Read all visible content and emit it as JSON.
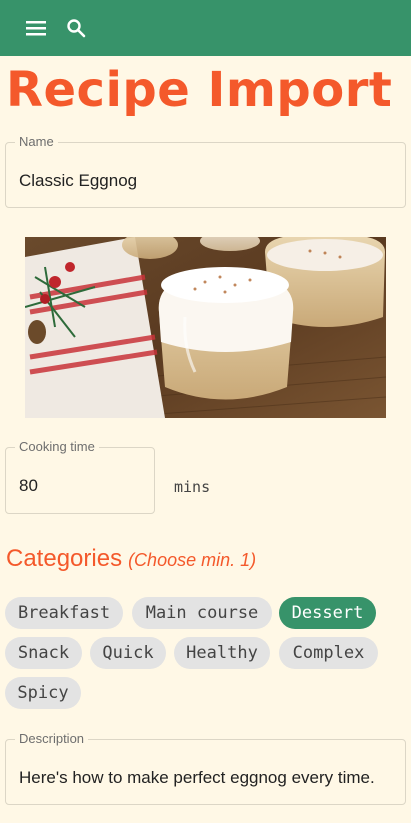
{
  "header": {
    "menu_icon": "menu-icon",
    "search_icon": "search-icon",
    "bar_color": "#37936a"
  },
  "page": {
    "title": "Recipe Import",
    "title_color": "#f4592b"
  },
  "name_field": {
    "label": "Name",
    "value": "Classic Eggnog"
  },
  "hero_image": {
    "subject": "eggnog glasses topped with whipped cream"
  },
  "cooking_time": {
    "label": "Cooking time",
    "value": "80",
    "unit": "mins"
  },
  "categories": {
    "heading": "Categories",
    "hint": "(Choose min. 1)",
    "items": [
      {
        "label": "Breakfast",
        "selected": false
      },
      {
        "label": "Main course",
        "selected": false
      },
      {
        "label": "Dessert",
        "selected": true
      },
      {
        "label": "Snack",
        "selected": false
      },
      {
        "label": "Quick",
        "selected": false
      },
      {
        "label": "Healthy",
        "selected": false
      },
      {
        "label": "Complex",
        "selected": false
      },
      {
        "label": "Spicy",
        "selected": false
      }
    ],
    "selected_color": "#37936a"
  },
  "description_field": {
    "label": "Description",
    "value": "Here's how to make perfect eggnog every time."
  }
}
